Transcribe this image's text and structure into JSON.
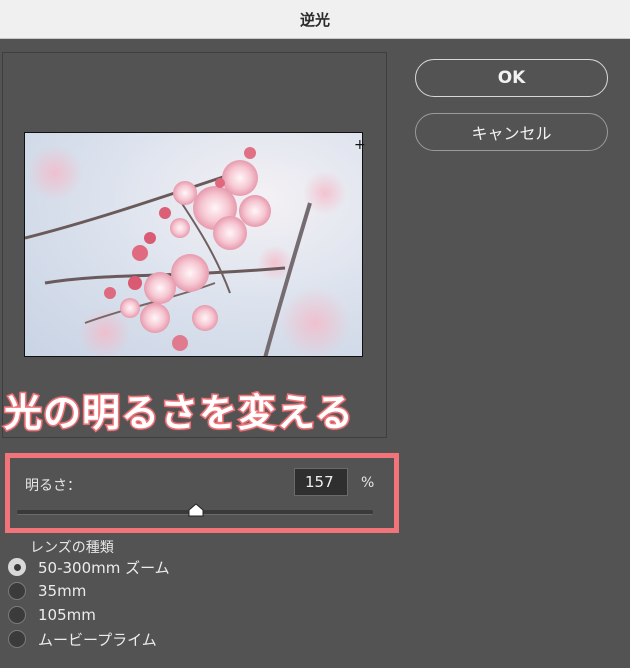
{
  "window": {
    "title": "逆光"
  },
  "buttons": {
    "ok": "OK",
    "cancel": "キャンセル"
  },
  "banner": {
    "text": "光の明るさを変える"
  },
  "brightness": {
    "label": "明るさ：",
    "value": "157",
    "unit": "%",
    "slider_fraction": 0.504
  },
  "lens": {
    "title": "レンズの種類",
    "options": [
      {
        "label": "50-300mm ズーム",
        "selected": true
      },
      {
        "label": "35mm",
        "selected": false
      },
      {
        "label": "105mm",
        "selected": false
      },
      {
        "label": "ムービープライム",
        "selected": false
      }
    ]
  },
  "colors": {
    "accent": "#f07479",
    "background": "#535353"
  }
}
